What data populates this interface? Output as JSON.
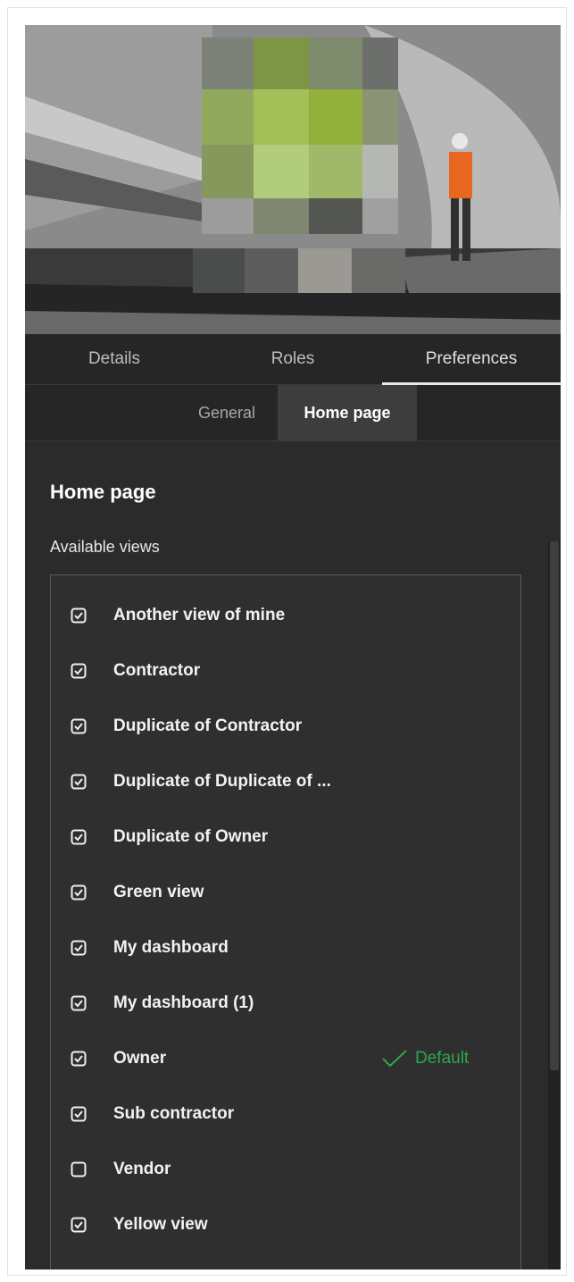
{
  "tabs": [
    {
      "label": "Details"
    },
    {
      "label": "Roles"
    },
    {
      "label": "Preferences"
    }
  ],
  "subtabs": [
    {
      "label": "General"
    },
    {
      "label": "Home page"
    }
  ],
  "section": {
    "title": "Home page",
    "subtitle": "Available views"
  },
  "views": [
    {
      "label": "Another view of mine",
      "checked": true
    },
    {
      "label": "Contractor",
      "checked": true
    },
    {
      "label": "Duplicate of Contractor",
      "checked": true
    },
    {
      "label": "Duplicate of Duplicate of ...",
      "checked": true
    },
    {
      "label": "Duplicate of Owner",
      "checked": true
    },
    {
      "label": "Green view",
      "checked": true
    },
    {
      "label": "My dashboard",
      "checked": true
    },
    {
      "label": "My dashboard (1)",
      "checked": true
    },
    {
      "label": "Owner",
      "checked": true,
      "default": "Default"
    },
    {
      "label": "Sub contractor",
      "checked": true
    },
    {
      "label": "Vendor",
      "checked": false
    },
    {
      "label": "Yellow view",
      "checked": true
    }
  ],
  "colors": {
    "panel_bg": "#2b2b2b",
    "default_green": "#2ea84a"
  }
}
